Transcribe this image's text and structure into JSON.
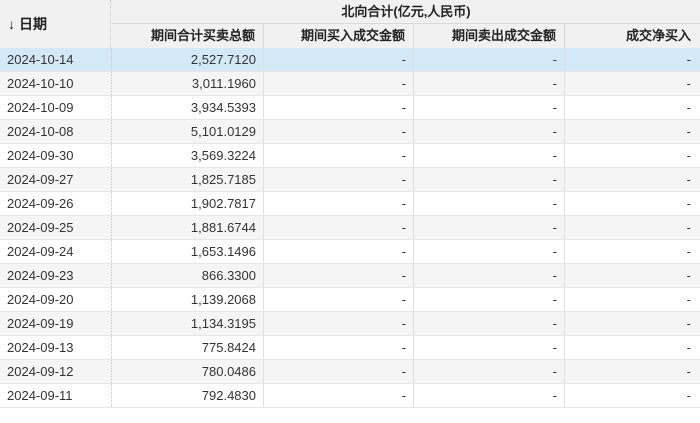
{
  "header": {
    "sort_arrow": "↓",
    "date_label": "日期",
    "group_title": "北向合计(亿元,人民币)",
    "columns": [
      "期间合计买卖总额",
      "期间买入成交金额",
      "期间卖出成交金额",
      "成交净买入"
    ]
  },
  "rows": [
    {
      "date": "2024-10-14",
      "total": "2,527.7120",
      "buy": "-",
      "sell": "-",
      "net": "-"
    },
    {
      "date": "2024-10-10",
      "total": "3,011.1960",
      "buy": "-",
      "sell": "-",
      "net": "-"
    },
    {
      "date": "2024-10-09",
      "total": "3,934.5393",
      "buy": "-",
      "sell": "-",
      "net": "-"
    },
    {
      "date": "2024-10-08",
      "total": "5,101.0129",
      "buy": "-",
      "sell": "-",
      "net": "-"
    },
    {
      "date": "2024-09-30",
      "total": "3,569.3224",
      "buy": "-",
      "sell": "-",
      "net": "-"
    },
    {
      "date": "2024-09-27",
      "total": "1,825.7185",
      "buy": "-",
      "sell": "-",
      "net": "-"
    },
    {
      "date": "2024-09-26",
      "total": "1,902.7817",
      "buy": "-",
      "sell": "-",
      "net": "-"
    },
    {
      "date": "2024-09-25",
      "total": "1,881.6744",
      "buy": "-",
      "sell": "-",
      "net": "-"
    },
    {
      "date": "2024-09-24",
      "total": "1,653.1496",
      "buy": "-",
      "sell": "-",
      "net": "-"
    },
    {
      "date": "2024-09-23",
      "total": "866.3300",
      "buy": "-",
      "sell": "-",
      "net": "-"
    },
    {
      "date": "2024-09-20",
      "total": "1,139.2068",
      "buy": "-",
      "sell": "-",
      "net": "-"
    },
    {
      "date": "2024-09-19",
      "total": "1,134.3195",
      "buy": "-",
      "sell": "-",
      "net": "-"
    },
    {
      "date": "2024-09-13",
      "total": "775.8424",
      "buy": "-",
      "sell": "-",
      "net": "-"
    },
    {
      "date": "2024-09-12",
      "total": "780.0486",
      "buy": "-",
      "sell": "-",
      "net": "-"
    },
    {
      "date": "2024-09-11",
      "total": "792.4830",
      "buy": "-",
      "sell": "-",
      "net": "-"
    }
  ],
  "selected_row": "2024-10-14",
  "colors": {
    "header_bg": "#f1f1f1",
    "selected_bg": "#d4e9f7",
    "alt_row_bg": "#f5f5f5"
  }
}
